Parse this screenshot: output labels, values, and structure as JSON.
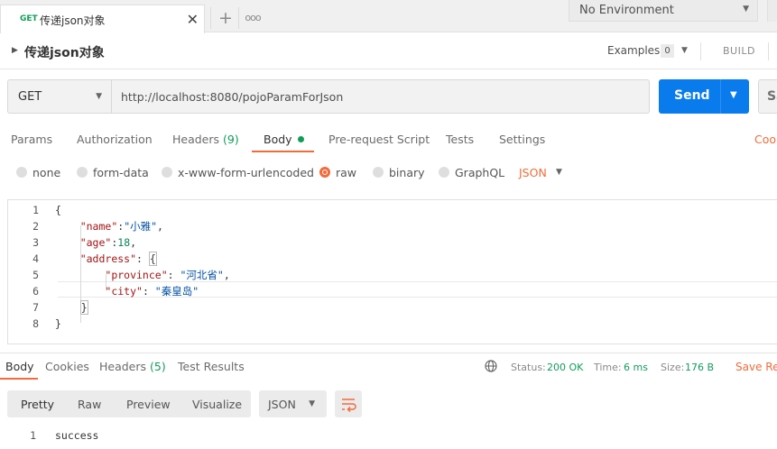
{
  "tab": {
    "method": "GET",
    "name": "传递json对象",
    "close": "✕",
    "new": "+",
    "more": "ooo"
  },
  "environment": {
    "selected": "No Environment"
  },
  "request": {
    "title": "传递json对象",
    "examples_label": "Examples",
    "examples_count": "0",
    "build_label": "BUILD",
    "method": "GET",
    "url": "http://localhost:8080/pojoParamForJson",
    "send_label": "Send",
    "save_label": "Sa"
  },
  "request_tabs": {
    "params": "Params",
    "authorization": "Authorization",
    "headers": "Headers",
    "headers_count": "(9)",
    "body": "Body",
    "pre_request": "Pre-request Script",
    "tests": "Tests",
    "settings": "Settings",
    "cookies": "Cool"
  },
  "body_types": {
    "none": "none",
    "form_data": "form-data",
    "urlencoded": "x-www-form-urlencoded",
    "raw": "raw",
    "binary": "binary",
    "graphql": "GraphQL",
    "format": "JSON",
    "selected": "raw"
  },
  "editor": {
    "lines": [
      {
        "num": "1",
        "indent": "",
        "parts": [
          [
            "p",
            "{"
          ]
        ]
      },
      {
        "num": "2",
        "indent": "    ",
        "parts": [
          [
            "k",
            "\"name\""
          ],
          [
            "p",
            ":"
          ],
          [
            "s",
            "\"小雅\""
          ],
          [
            "p",
            ","
          ]
        ]
      },
      {
        "num": "3",
        "indent": "    ",
        "parts": [
          [
            "k",
            "\"age\""
          ],
          [
            "p",
            ":"
          ],
          [
            "n",
            "18"
          ],
          [
            "p",
            ","
          ]
        ]
      },
      {
        "num": "4",
        "indent": "    ",
        "parts": [
          [
            "k",
            "\"address\""
          ],
          [
            "p",
            ": "
          ],
          [
            "b",
            "{"
          ]
        ]
      },
      {
        "num": "5",
        "indent": "        ",
        "parts": [
          [
            "k",
            "\"province\""
          ],
          [
            "p",
            ": "
          ],
          [
            "s",
            "\"河北省\""
          ],
          [
            "p",
            ","
          ]
        ]
      },
      {
        "num": "6",
        "indent": "        ",
        "parts": [
          [
            "k",
            "\"city\""
          ],
          [
            "p",
            ": "
          ],
          [
            "s",
            "\"秦皇岛\""
          ]
        ]
      },
      {
        "num": "7",
        "indent": "    ",
        "parts": [
          [
            "b",
            "}"
          ]
        ]
      },
      {
        "num": "8",
        "indent": "",
        "parts": [
          [
            "p",
            "}"
          ]
        ]
      }
    ]
  },
  "response": {
    "tabs": {
      "body": "Body",
      "cookies": "Cookies",
      "headers": "Headers",
      "headers_count": "(5)",
      "test_results": "Test Results"
    },
    "status_label": "Status:",
    "status_value": "200 OK",
    "time_label": "Time:",
    "time_value": "6 ms",
    "size_label": "Size:",
    "size_value": "176 B",
    "save_label": "Save Res",
    "views": {
      "pretty": "Pretty",
      "raw": "Raw",
      "preview": "Preview",
      "visualize": "Visualize"
    },
    "format": "JSON",
    "body_lines": [
      {
        "num": "1",
        "text": "success"
      }
    ]
  },
  "colors": {
    "accent": "#f26b3a",
    "send": "#097bed",
    "success": "#0f9d58"
  },
  "icons": [
    "close-icon",
    "plus-icon",
    "more-icon",
    "chevron-down-icon",
    "caret-right-icon",
    "globe-icon",
    "wrap-lines-icon"
  ]
}
